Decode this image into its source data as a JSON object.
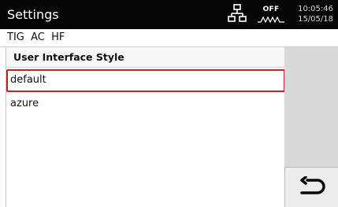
{
  "titlebar": {
    "title": "Settings",
    "status_off": "OFF",
    "time": "10:05:46",
    "date": "15/05/18",
    "icons": {
      "network": "network-icon",
      "wave": "wave-icon"
    }
  },
  "mode": "TIG  AC  HF",
  "panel": {
    "title": "User Interface Style",
    "items": [
      {
        "label": "default",
        "selected": true
      },
      {
        "label": "azure",
        "selected": false
      }
    ]
  },
  "buttons": {
    "back": "return-arrow-icon"
  },
  "colors": {
    "titlebar": "#060606",
    "selection": "#c3202a",
    "sidebar": "#d8d8d8"
  }
}
